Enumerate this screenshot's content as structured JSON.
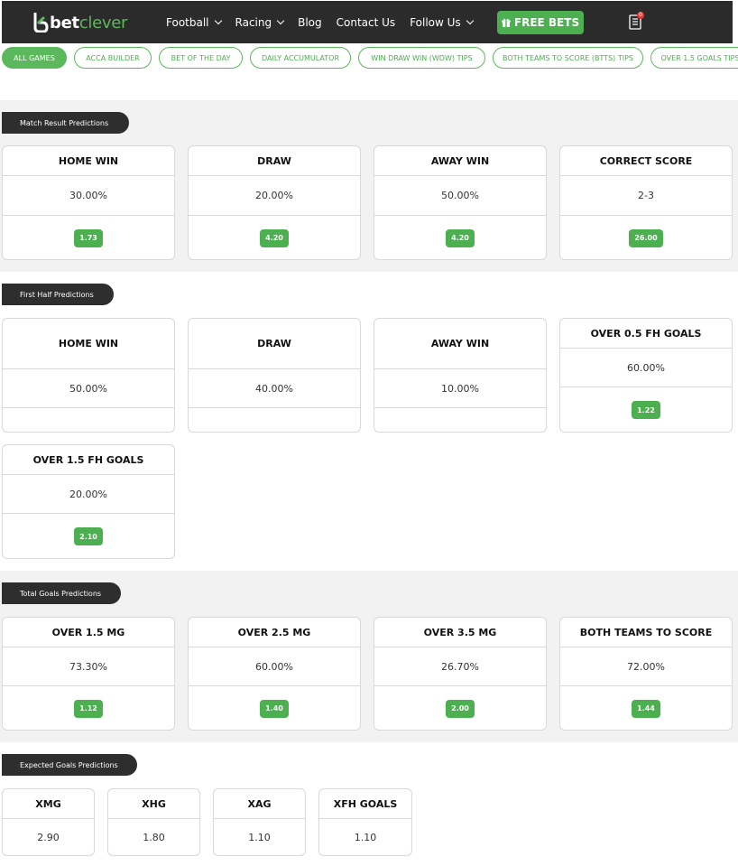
{
  "nav": {
    "logo_bet": "bet",
    "logo_clever": "clever",
    "links": [
      {
        "label": "Football",
        "dropdown": true
      },
      {
        "label": "Racing",
        "dropdown": true
      },
      {
        "label": "Blog",
        "dropdown": false
      },
      {
        "label": "Contact Us",
        "dropdown": false
      },
      {
        "label": "Follow Us",
        "dropdown": true
      }
    ],
    "free_bets_label": "FREE BETS",
    "free_bets_icon": "gift-icon",
    "betslip_icon": "betslip-icon",
    "betslip_count": "0"
  },
  "pills": [
    "ALL GAMES",
    "ACCA BUILDER",
    "BET OF THE DAY",
    "DAILY ACCUMULATOR",
    "WIN DRAW WIN (WDW) TIPS",
    "BOTH TEAMS TO SCORE (BTTS) TIPS",
    "OVER 1.5 GOALS TIPS"
  ],
  "colors": {
    "accent_green": "#4caf50",
    "nav_bg": "#2b2b2b",
    "section_grey": "#f2f2f2"
  },
  "sections": {
    "match_result": {
      "label": "Match Result Predictions",
      "cards": [
        {
          "title": "HOME WIN",
          "pct": "30.00%",
          "odds": "1.73"
        },
        {
          "title": "DRAW",
          "pct": "20.00%",
          "odds": "4.20"
        },
        {
          "title": "AWAY WIN",
          "pct": "50.00%",
          "odds": "4.20"
        },
        {
          "title": "CORRECT SCORE",
          "pct": "2-3",
          "odds": "26.00"
        }
      ]
    },
    "first_half": {
      "label": "First Half Predictions",
      "cards": [
        {
          "title": "HOME WIN",
          "pct": "50.00%",
          "odds": ""
        },
        {
          "title": "DRAW",
          "pct": "40.00%",
          "odds": ""
        },
        {
          "title": "AWAY WIN",
          "pct": "10.00%",
          "odds": ""
        },
        {
          "title": "OVER 0.5 FH GOALS",
          "pct": "60.00%",
          "odds": "1.22"
        },
        {
          "title": "OVER 1.5 FH GOALS",
          "pct": "20.00%",
          "odds": "2.10"
        }
      ]
    },
    "total_goals": {
      "label": "Total Goals Predictions",
      "cards": [
        {
          "title": "OVER 1.5 MG",
          "pct": "73.30%",
          "odds": "1.12"
        },
        {
          "title": "OVER 2.5 MG",
          "pct": "60.00%",
          "odds": "1.40"
        },
        {
          "title": "OVER 3.5 MG",
          "pct": "26.70%",
          "odds": "2.00"
        },
        {
          "title": "BOTH TEAMS TO SCORE",
          "pct": "72.00%",
          "odds": "1.44"
        }
      ]
    },
    "expected_goals": {
      "label": "Expected Goals Predictions",
      "cards": [
        {
          "title": "XMG",
          "value": "2.90"
        },
        {
          "title": "XHG",
          "value": "1.80"
        },
        {
          "title": "XAG",
          "value": "1.10"
        },
        {
          "title": "XFH GOALS",
          "value": "1.10"
        }
      ]
    }
  }
}
